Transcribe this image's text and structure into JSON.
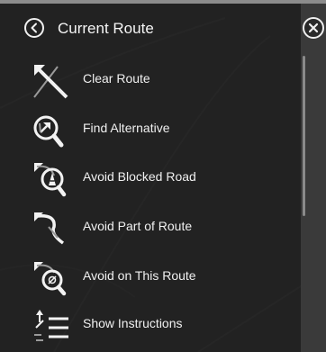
{
  "header": {
    "title": "Current Route"
  },
  "menu": {
    "items": [
      {
        "label": "Clear Route",
        "icon": "clear-route-icon"
      },
      {
        "label": "Find Alternative",
        "icon": "find-alternative-icon"
      },
      {
        "label": "Avoid Blocked Road",
        "icon": "avoid-blocked-road-icon"
      },
      {
        "label": "Avoid Part of Route",
        "icon": "avoid-part-of-route-icon"
      },
      {
        "label": "Avoid on This Route",
        "icon": "avoid-on-this-route-icon"
      },
      {
        "label": "Show Instructions",
        "icon": "show-instructions-icon"
      }
    ]
  },
  "colors": {
    "panel_bg": "#1e1e1e",
    "text": "#f0f0f0",
    "scrollbar": "#8a8a8a"
  }
}
